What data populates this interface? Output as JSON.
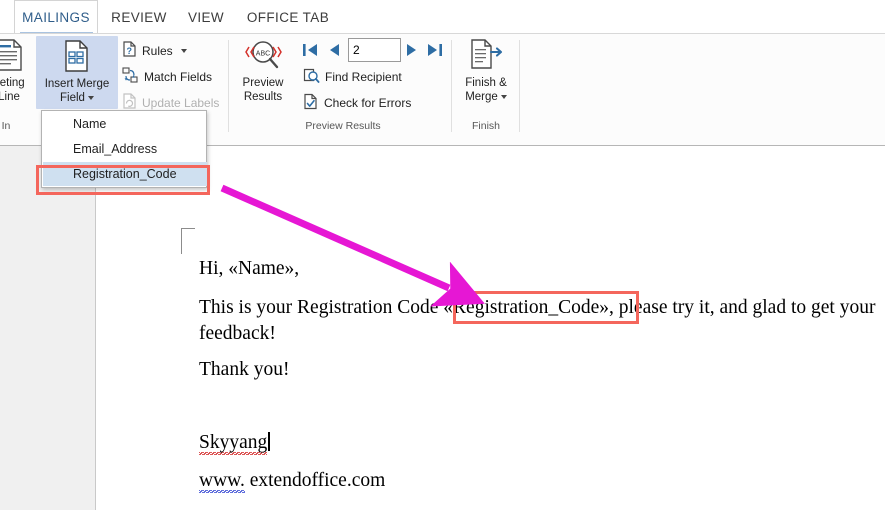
{
  "window": {
    "app": "Microsoft Word",
    "accent_blue": "#2f5d8a",
    "highlight_red": "#f4665c",
    "arrow_magenta": "#e617d4",
    "selected_menu_bg": "#cfe0f0",
    "hot_button_bg": "#cdd9ef"
  },
  "tabs": [
    {
      "label": "MAILINGS",
      "active": true
    },
    {
      "label": "REVIEW",
      "active": false
    },
    {
      "label": "VIEW",
      "active": false
    },
    {
      "label": "OFFICE TAB",
      "active": false
    }
  ],
  "ribbon": {
    "groups": [
      {
        "label": "te & In",
        "full_label": "Write & Insert Fields"
      },
      {
        "label": "Preview Results"
      },
      {
        "label": "Finish"
      }
    ],
    "write_insert": {
      "greeting_line": {
        "label_line1": "eeting",
        "label_line2": "Line",
        "icon": "greeting-line-icon"
      },
      "insert_merge_field": {
        "label_line1": "Insert Merge",
        "label_line2": "Field",
        "icon": "insert-merge-field-icon",
        "has_caret": true,
        "highlighted": true
      },
      "rules": {
        "label": "Rules",
        "icon": "rules-icon",
        "has_caret": true,
        "disabled": false
      },
      "match_fields": {
        "label": "Match Fields",
        "icon": "match-fields-icon",
        "disabled": false
      },
      "update_labels": {
        "label": "Update Labels",
        "icon": "update-labels-icon",
        "disabled": true
      }
    },
    "preview_results": {
      "preview_button": {
        "label_line1": "Preview",
        "label_line2": "Results",
        "icon": "preview-results-icon"
      },
      "nav_first": {
        "icon": "nav-first-record-icon"
      },
      "nav_prev": {
        "icon": "nav-previous-record-icon"
      },
      "record_number": {
        "value": "2",
        "placeholder": ""
      },
      "nav_next": {
        "icon": "nav-next-record-icon"
      },
      "nav_last": {
        "icon": "nav-last-record-icon"
      },
      "find_recipient": {
        "label": "Find Recipient",
        "icon": "find-recipient-icon"
      },
      "check_for_errors": {
        "label": "Check for Errors",
        "icon": "check-for-errors-icon"
      }
    },
    "finish": {
      "finish_merge": {
        "label_line1": "Finish &",
        "label_line2": "Merge",
        "icon": "finish-and-merge-icon",
        "has_caret": true
      }
    }
  },
  "dropdown": {
    "open": true,
    "items": [
      {
        "label": "Name",
        "selected": false
      },
      {
        "label": "Email_Address",
        "selected": false
      },
      {
        "label": "Registration_Code",
        "selected": true
      }
    ]
  },
  "document": {
    "lines": [
      {
        "id": "greeting",
        "text": "Hi, «Name»,"
      },
      {
        "id": "body_part1",
        "text": "This is your Registration Code "
      },
      {
        "id": "body_field",
        "text": "«Registration_Code»"
      },
      {
        "id": "body_part2",
        "text": ", please try it, and glad to get your feedback!"
      },
      {
        "id": "thanks",
        "text": "Thank you!"
      },
      {
        "id": "signature",
        "text": "Skyyang"
      },
      {
        "id": "url_prefix",
        "text": "www."
      },
      {
        "id": "url_rest",
        "text": " extendoffice.com"
      }
    ]
  }
}
